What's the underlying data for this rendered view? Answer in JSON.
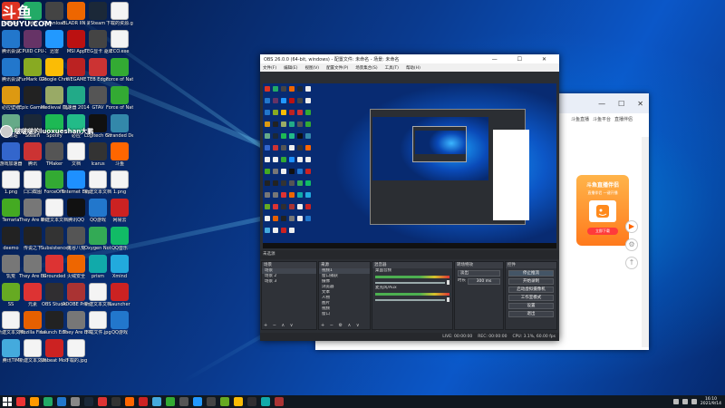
{
  "brand": {
    "logo": "斗鱼",
    "url": "DOUYU.COM"
  },
  "overlay": {
    "text": "啵啵啵的luoxueshan大鹏"
  },
  "desktop_icons": [
    {
      "label": "ADobe",
      "color": "#d32"
    },
    {
      "label": "网络",
      "color": "#2a6"
    },
    {
      "label": "Download",
      "color": "#444"
    },
    {
      "label": "BLADR IIN 跳舞资源",
      "color": "#e60"
    },
    {
      "label": "Steam",
      "color": "#1b2838"
    },
    {
      "label": "下载的资源.gif",
      "color": "#888",
      "doc": true
    },
    {
      "label": "腾讯会议",
      "color": "#27c"
    },
    {
      "label": "CPUID CPU-Z",
      "color": "#636"
    },
    {
      "label": "迅雷",
      "color": "#29f"
    },
    {
      "label": "MSI App",
      "color": "#b11"
    },
    {
      "label": "TEG显卡 驱动",
      "color": "#444"
    },
    {
      "label": "ECO.exe",
      "color": "#777",
      "doc": true
    },
    {
      "label": "腾讯会议",
      "color": "#27c"
    },
    {
      "label": "FurMark GPU-Z",
      "color": "#8a2"
    },
    {
      "label": "Google Chrome",
      "color": "#fbbc05"
    },
    {
      "label": "WEGAME",
      "color": "#b22"
    },
    {
      "label": "TEB Edge",
      "color": "#c33"
    },
    {
      "label": "Force of Nature 2",
      "color": "#3a3"
    },
    {
      "label": "必应壁纸",
      "color": "#d91"
    },
    {
      "label": "Epic Games Launcher",
      "color": "#222"
    },
    {
      "label": "Medieval Dynasty",
      "color": "#9a6"
    },
    {
      "label": "加速器 2014",
      "color": "#2a8"
    },
    {
      "label": "GTAV",
      "color": "#555"
    },
    {
      "label": "Force of Nature",
      "color": "#3a3"
    },
    {
      "label": "回收站",
      "color": "#6a8"
    },
    {
      "label": "Steam",
      "color": "#1b2838"
    },
    {
      "label": "Spotify",
      "color": "#1db954"
    },
    {
      "label": "必应",
      "color": "#2b8"
    },
    {
      "label": "Logitech G HUB",
      "color": "#111"
    },
    {
      "label": "Stranded Deep",
      "color": "#38a"
    },
    {
      "label": "游戏加速器",
      "color": "#36c"
    },
    {
      "label": "腾讯",
      "color": "#c33"
    },
    {
      "label": "TMaker",
      "color": "#555"
    },
    {
      "label": "文档",
      "color": "#888",
      "doc": true
    },
    {
      "label": "Icarus",
      "color": "#333"
    },
    {
      "label": "斗鱼",
      "color": "#f60"
    },
    {
      "label": "1.png",
      "color": "#888",
      "doc": true
    },
    {
      "label": "口口截图",
      "color": "#888",
      "doc": true
    },
    {
      "label": "ForceOfN",
      "color": "#3a3"
    },
    {
      "label": "Internet Explorer",
      "color": "#1e90ff"
    },
    {
      "label": "新建文本文档",
      "color": "#888",
      "doc": true
    },
    {
      "label": "1.png",
      "color": "#888",
      "doc": true
    },
    {
      "label": "Terraria",
      "color": "#4a2"
    },
    {
      "label": "They Are Billions",
      "color": "#777"
    },
    {
      "label": "新建文本文档",
      "color": "#888",
      "doc": true
    },
    {
      "label": "腾讯QQ",
      "color": "#111"
    },
    {
      "label": "QQ游戏",
      "color": "#27c"
    },
    {
      "label": "网易云",
      "color": "#c22"
    },
    {
      "label": "deemo",
      "color": "#222"
    },
    {
      "label": "传说之下",
      "color": "#222"
    },
    {
      "label": "Subsistence",
      "color": "#333"
    },
    {
      "label": "鬼谷八荒",
      "color": "#555"
    },
    {
      "label": "Oxygen Not Included",
      "color": "#3a5"
    },
    {
      "label": "QQ音乐",
      "color": "#1b6"
    },
    {
      "label": "饥荒",
      "color": "#777"
    },
    {
      "label": "They Are Billions",
      "color": "#777"
    },
    {
      "label": "Grounded",
      "color": "#d33"
    },
    {
      "label": "火绒安全",
      "color": "#e60"
    },
    {
      "label": "prism",
      "color": "#1aa"
    },
    {
      "label": "Xmind",
      "color": "#2ad"
    },
    {
      "label": "SS",
      "color": "#6a2"
    },
    {
      "label": "元素",
      "color": "#d33"
    },
    {
      "label": "OBS Studio",
      "color": "#302e31"
    },
    {
      "label": "ADOBE Premiere",
      "color": "#a33"
    },
    {
      "label": "新建文本文档",
      "color": "#888",
      "doc": true
    },
    {
      "label": "Launcher",
      "color": "#c22"
    },
    {
      "label": "新建文本文档",
      "color": "#888",
      "doc": true
    },
    {
      "label": "Mozilla Firefox",
      "color": "#e66000"
    },
    {
      "label": "Launch Editor",
      "color": "#222"
    },
    {
      "label": "They Are Billions",
      "color": "#777"
    },
    {
      "label": "下载文件.jpg",
      "color": "#888",
      "doc": true
    },
    {
      "label": "QQ游戏",
      "color": "#27c"
    },
    {
      "label": "腾讯TIM",
      "color": "#4ad"
    },
    {
      "label": "新建文本文档",
      "color": "#888",
      "doc": true
    },
    {
      "label": "Unbeat Mode",
      "color": "#c22"
    },
    {
      "label": "下载的.jpg",
      "color": "#888",
      "doc": true
    }
  ],
  "obs": {
    "title": "OBS 26.0.0 (64-bit, windows) - 配置文件: 未命名 - 场景: 未命名",
    "window_controls": "— ☐ ✕",
    "menu": [
      "文件(F)",
      "编辑(E)",
      "视图(V)",
      "配置文件(P)",
      "场景集合(S)",
      "工具(T)",
      "帮助(H)"
    ],
    "dock_strip": "未选源",
    "scenes": {
      "header": "场景",
      "items": [
        "场景",
        "场景 2",
        "场景 3"
      ],
      "footer": "+ − ∧ ∨"
    },
    "sources": {
      "header": "来源",
      "items": [
        "视频1",
        "窗口捕获",
        "摄像",
        "浏览器",
        "文本",
        "人物",
        "图片",
        "视频",
        "窗口"
      ],
      "footer": "+ − ⚙ ∧ ∨"
    },
    "mixer": {
      "header": "混音器",
      "channels": [
        "桌面音频",
        "麦克风/Aux"
      ]
    },
    "transitions": {
      "header": "转场特效",
      "mode": "淡出",
      "duration_label": "时长",
      "duration": "300 ms"
    },
    "controls": {
      "header": "控件",
      "buttons": [
        "停止推流",
        "开始录制",
        "启动虚拟摄像机",
        "工作室模式",
        "设置",
        "退出"
      ]
    },
    "status": [
      "LIVE: 00:00:00",
      "REC: 00:00:00",
      "CPU: 3.1%, 60.00 fps"
    ]
  },
  "browser": {
    "controls": [
      "—",
      "☐",
      "✕"
    ],
    "tabs": [
      "斗鱼直播",
      "斗鱼平台",
      "直播伴侣"
    ],
    "card": {
      "title": "斗鱼直播伴侣",
      "subtitle": "直播伴侣 一键开播",
      "button": "立即下载"
    }
  },
  "tray": {
    "time": "16:10",
    "date": "2021/9/14"
  }
}
